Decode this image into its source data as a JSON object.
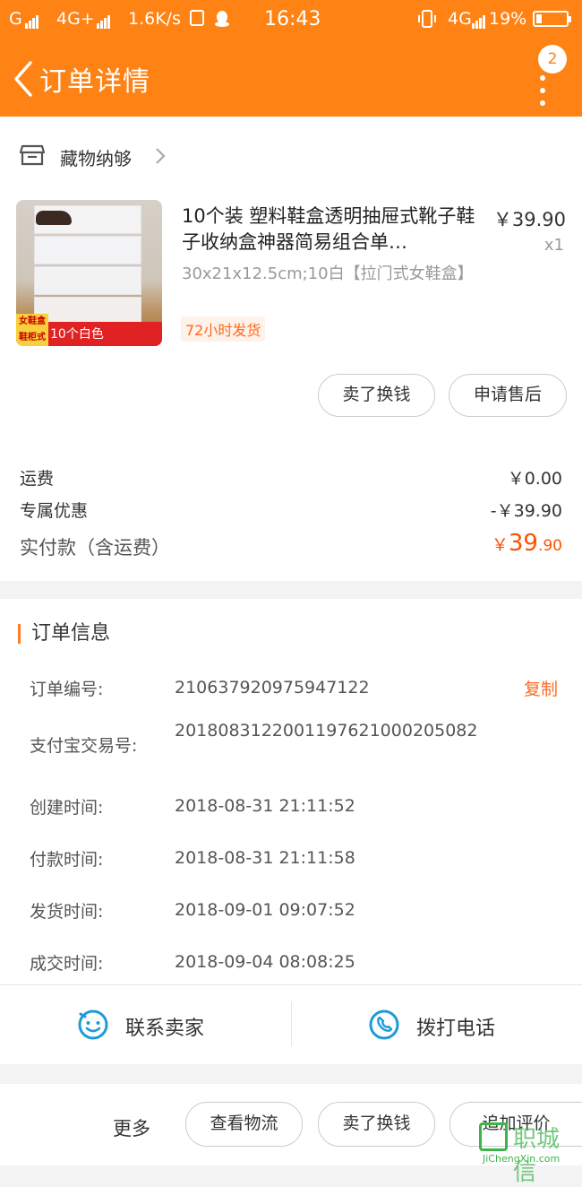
{
  "status_bar": {
    "carrier1": "G",
    "network": "4G+",
    "speed": "1.6K/s",
    "time": "16:43",
    "network2": "4G",
    "battery": "19%",
    "battery_level": 0.19
  },
  "header": {
    "title": "订单详情",
    "badge_count": "2"
  },
  "shop": {
    "name": "藏物纳够"
  },
  "product": {
    "image_tag": "女鞋盒 鞋柜式",
    "image_caption": "10个白色",
    "title": "10个装 塑料鞋盒透明抽屉式靴子鞋子收纳盒神器简易组合单…",
    "sku": "30x21x12.5cm;10白【拉门式女鞋盒】",
    "shipping_tag": "72小时发货",
    "price": "￥39.90",
    "quantity": "x1"
  },
  "product_actions": {
    "resell": "卖了换钱",
    "after_sale": "申请售后"
  },
  "fees": {
    "shipping_label": "运费",
    "shipping_value": "￥0.00",
    "discount_label": "专属优惠",
    "discount_value": "-￥39.90",
    "total_label": "实付款（含运费）",
    "total_currency": "￥",
    "total_int": "39",
    "total_dec": ".90"
  },
  "order_info": {
    "heading": "订单信息",
    "copy_label": "复制",
    "rows": [
      {
        "key": "订单编号:",
        "value": "210637920975947122"
      },
      {
        "key": "支付宝交易号:",
        "value": "2018083122001197621000205082"
      },
      {
        "key": "创建时间:",
        "value": "2018-08-31 21:11:52"
      },
      {
        "key": "付款时间:",
        "value": "2018-08-31 21:11:58"
      },
      {
        "key": "发货时间:",
        "value": "2018-09-01 09:07:52"
      },
      {
        "key": "成交时间:",
        "value": "2018-09-04 08:08:25"
      }
    ]
  },
  "contact": {
    "seller": "联系卖家",
    "phone": "拨打电话"
  },
  "bottom_bar": {
    "more": "更多",
    "logistics": "查看物流",
    "resell": "卖了换钱",
    "review": "追加评价"
  },
  "watermark": {
    "text": "职城信",
    "domain": "JiChengXin.com"
  },
  "colors": {
    "header": "#ff8214",
    "accent": "#ff5000",
    "link": "#ff6a1f",
    "icon_blue": "#1e9bd7"
  }
}
